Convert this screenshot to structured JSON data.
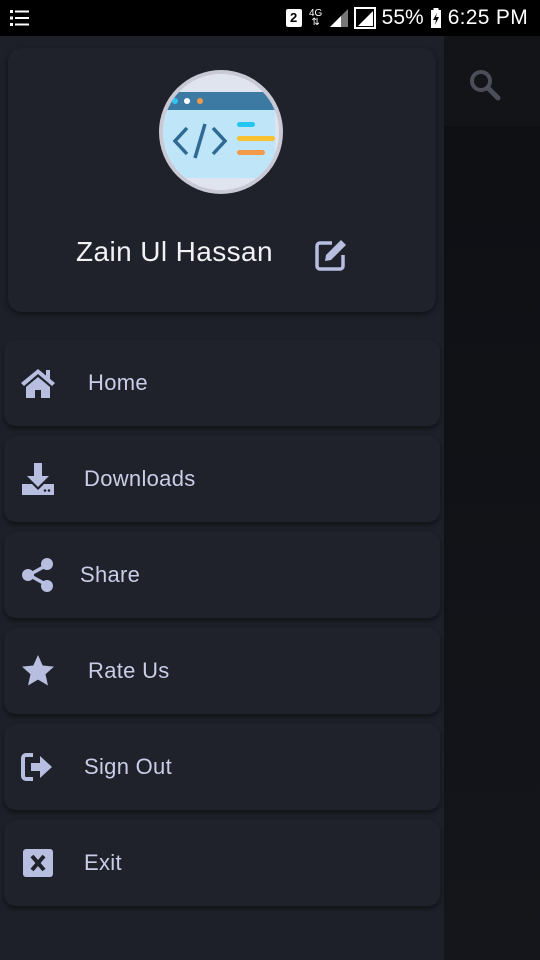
{
  "status_bar": {
    "sim": "2",
    "network": "4G",
    "battery": "55%",
    "time": "6:25 PM"
  },
  "profile": {
    "name": "Zain Ul Hassan"
  },
  "menu": [
    {
      "label": "Home",
      "icon": "home-icon"
    },
    {
      "label": "Downloads",
      "icon": "download-icon"
    },
    {
      "label": "Share",
      "icon": "share-icon"
    },
    {
      "label": "Rate Us",
      "icon": "star-icon"
    },
    {
      "label": "Sign Out",
      "icon": "sign-out-icon"
    },
    {
      "label": "Exit",
      "icon": "exit-icon"
    }
  ],
  "colors": {
    "drawer_bg": "#1d2029",
    "card_bg": "#1f222b",
    "icon": "#b7bedf",
    "text": "#c9cde6"
  }
}
